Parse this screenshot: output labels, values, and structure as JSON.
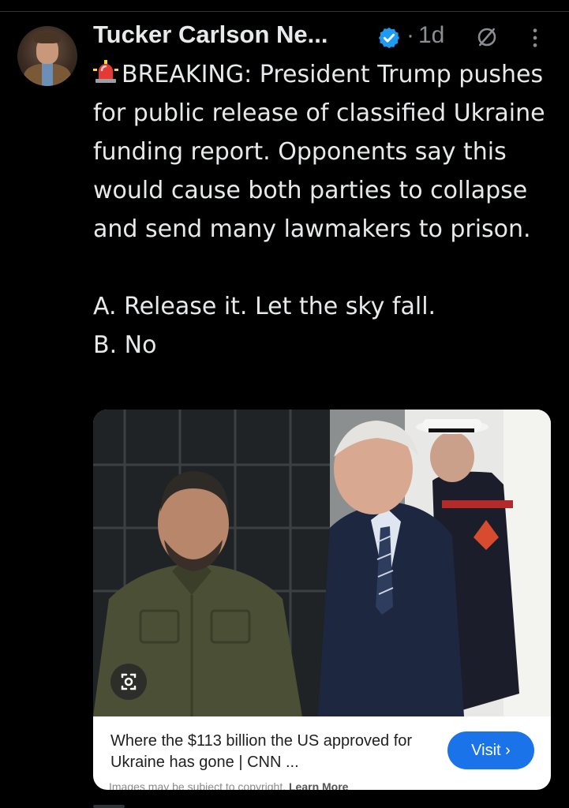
{
  "post": {
    "author": {
      "display_name": "Tucker Carlson Ne...",
      "verified": true,
      "avatar_icon": "profile-photo"
    },
    "separator": "·",
    "timestamp": "1d",
    "grok_icon": "grok-slash-icon",
    "more_icon": "vertical-ellipsis-icon",
    "text": {
      "siren_icon": "rotating-light-emoji",
      "paragraph_1": "BREAKING: President Trump pushes for public release of classified Ukraine funding report. Opponents say this would cause both parties to collapse and send many lawmakers to prison.",
      "option_a": "A. Release it. Let the sky fall.",
      "option_b": "B. No"
    },
    "card": {
      "caption": "Where the $113 billion the US approved for Ukraine has gone | CNN ...",
      "visit_label": "Visit ›",
      "disclaimer": "Images may be subject to copyright.",
      "learn_more": "Learn More",
      "lens_icon": "google-lens-icon"
    }
  },
  "colors": {
    "background": "#000000",
    "text_primary": "#e7e9ea",
    "text_secondary": "#8b8f93",
    "verified_blue": "#1d9bf0",
    "visit_button": "#1a73e8"
  }
}
